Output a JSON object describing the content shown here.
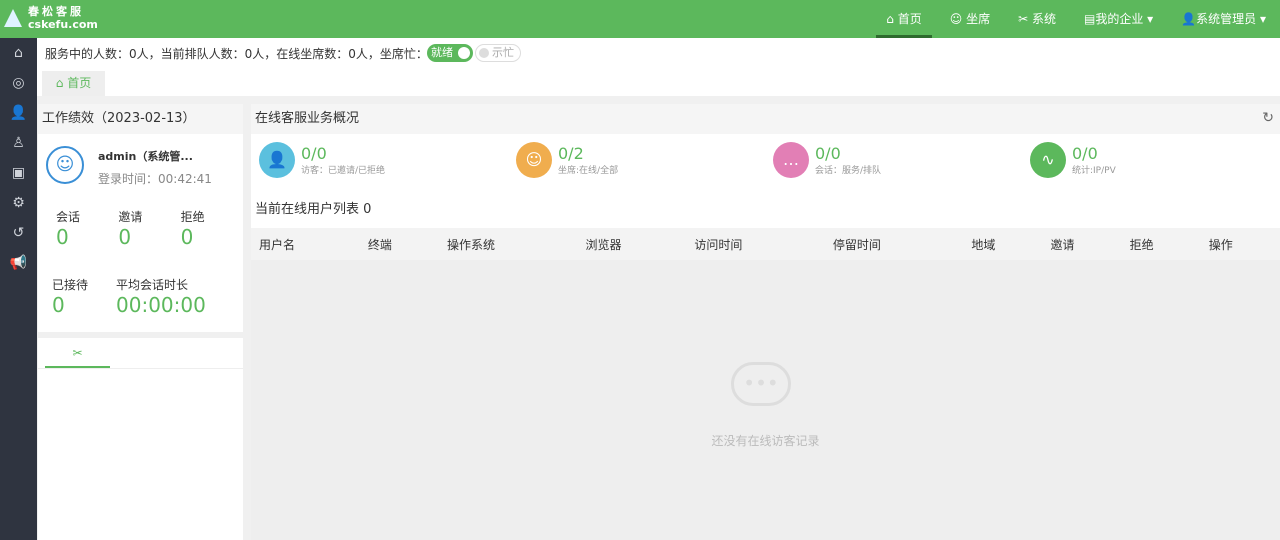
{
  "logo": {
    "cn": "春松客服",
    "en": "cskefu.com"
  },
  "nav": [
    {
      "icon": "⌂",
      "label": "首页"
    },
    {
      "icon": "☺",
      "label": "坐席"
    },
    {
      "icon": "✂",
      "label": "系统"
    },
    {
      "icon": "▤",
      "label": "我的企业 ▾"
    },
    {
      "icon": "👤",
      "label": "系统管理员 ▾"
    }
  ],
  "sidebar": [
    "⌂",
    "◎",
    "👤",
    "♙",
    "▣",
    "⚙",
    "↺",
    "📢"
  ],
  "status_line": "服务中的人数：0人，当前排队人数：0人，在线坐席数：0人，坐席忙：0人",
  "toggle_ready": "就绪",
  "toggle_busy": "示忙",
  "tab": "⌂ 首页",
  "perf": {
    "title": "工作绩效（2023-02-13）",
    "user": "admin（系统管...",
    "login": "登录时间：00:42:41",
    "stats": [
      {
        "label": "会话",
        "value": "0"
      },
      {
        "label": "邀请",
        "value": "0"
      },
      {
        "label": "拒绝",
        "value": "0"
      }
    ],
    "served_label": "已接待",
    "served": "0",
    "avg_label": "平均会话时长",
    "avg": "00:00:00"
  },
  "overview": {
    "title": "在线客服业务概况",
    "items": [
      {
        "value": "0/0",
        "label": "访客：已邀请/已拒绝",
        "color": "#5bc0de"
      },
      {
        "value": "0/2",
        "label": "坐席:在线/全部",
        "color": "#f0ad4e"
      },
      {
        "value": "0/0",
        "label": "会话：服务/排队",
        "color": "#e27fb5"
      },
      {
        "value": "0/0",
        "label": "统计:IP/PV",
        "color": "#5cb85c"
      }
    ]
  },
  "online": {
    "title": "当前在线用户列表 0",
    "columns": [
      "用户名",
      "终端",
      "操作系统",
      "浏览器",
      "访问时间",
      "停留时间",
      "地域",
      "邀请",
      "拒绝",
      "操作"
    ],
    "empty": "还没有在线访客记录"
  }
}
